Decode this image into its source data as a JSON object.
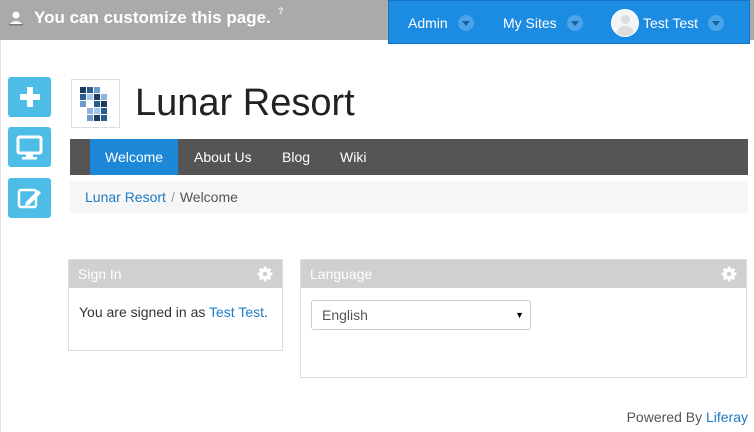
{
  "dockbar": {
    "customize_message": "You can customize this page.",
    "help_mark": "?",
    "menus": [
      {
        "label": "Admin"
      },
      {
        "label": "My Sites"
      },
      {
        "label": "Test Test"
      }
    ]
  },
  "side_buttons": [
    {
      "icon": "plus-icon"
    },
    {
      "icon": "monitor-icon"
    },
    {
      "icon": "edit-icon"
    }
  ],
  "site": {
    "title": "Lunar Resort"
  },
  "nav": {
    "items": [
      {
        "label": "Welcome",
        "active": true
      },
      {
        "label": "About Us"
      },
      {
        "label": "Blog"
      },
      {
        "label": "Wiki"
      }
    ]
  },
  "breadcrumb": {
    "items": [
      "Lunar Resort",
      "Welcome"
    ],
    "separator": "/"
  },
  "sign_in": {
    "title": "Sign In",
    "prefix": "You are signed in as",
    "user": "Test Test",
    "suffix": "."
  },
  "language": {
    "title": "Language",
    "selected": "English"
  },
  "footer": {
    "powered_by": "Powered By",
    "brand": "Liferay"
  },
  "colors": {
    "dockbar": "#aaaaaa",
    "admin_bar": "#1c8be2",
    "side_button": "#4dbde8",
    "nav_bar": "#555555",
    "nav_active": "#1e88d8",
    "link": "#1e7bc4",
    "portlet_header": "#d0d0d0"
  }
}
